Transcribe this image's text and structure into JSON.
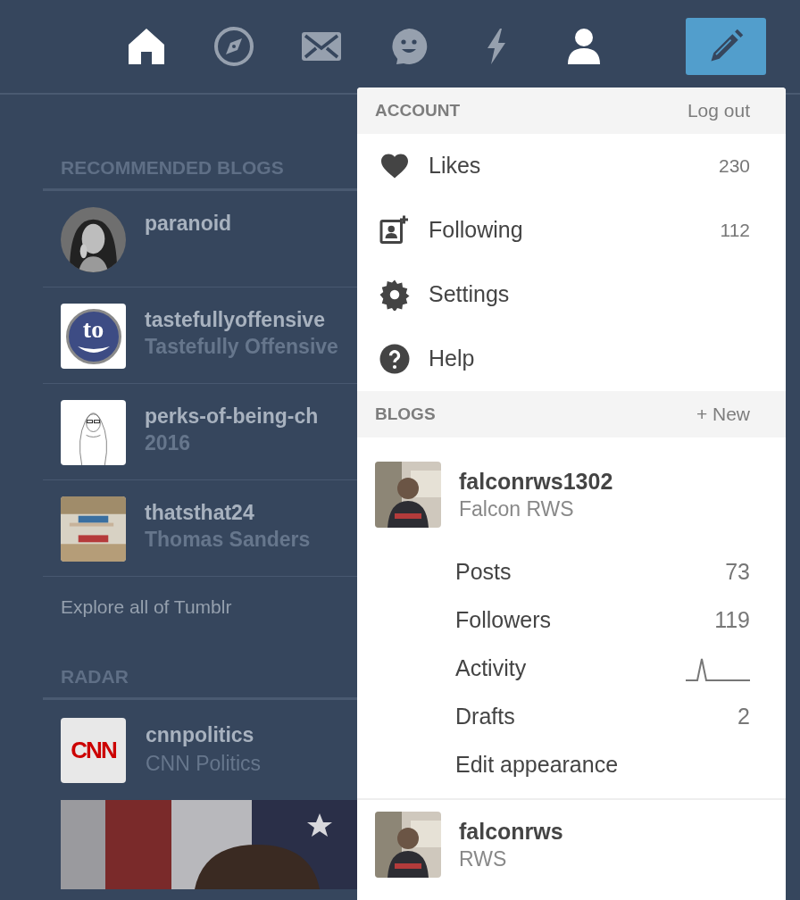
{
  "nav": [
    {
      "kind": "home",
      "selected": true
    },
    {
      "kind": "explore",
      "selected": false
    },
    {
      "kind": "inbox",
      "selected": false
    },
    {
      "kind": "messaging",
      "selected": false
    },
    {
      "kind": "activity",
      "selected": false
    },
    {
      "kind": "account",
      "selected": true
    }
  ],
  "recommended": {
    "heading": "RECOMMENDED BLOGS",
    "blogs": [
      {
        "kind": "picture",
        "name": "paranoid"
      },
      {
        "kind": "logo",
        "logo_text": "to",
        "name": "tastefullyoffensive",
        "title": "Tastefully Offensive"
      },
      {
        "kind": "sketch",
        "name": "perks-of-being-ch",
        "title": "2016"
      },
      {
        "kind": "picture",
        "name": "thatsthat24",
        "title": "Thomas Sanders"
      }
    ],
    "explore": "Explore all of Tumblr"
  },
  "radar": {
    "heading": "RADAR",
    "blog": {
      "logo_text": "CNN",
      "name": "cnnpolitics",
      "title": "CNN Politics"
    }
  },
  "account_menu": {
    "heading": "ACCOUNT",
    "logout": "Log out",
    "items": [
      {
        "kind": "likes",
        "label": "Likes",
        "count": "230"
      },
      {
        "kind": "following",
        "label": "Following",
        "count": "112"
      },
      {
        "kind": "settings",
        "label": "Settings"
      },
      {
        "kind": "help",
        "label": "Help"
      }
    ],
    "blogs_heading": "BLOGS",
    "new": "+ New",
    "blogs": [
      {
        "name": "falconrws1302",
        "title": "Falcon RWS",
        "stats": [
          {
            "kind": "count",
            "label": "Posts",
            "value": "73"
          },
          {
            "kind": "count",
            "label": "Followers",
            "value": "119"
          },
          {
            "kind": "sparkline",
            "label": "Activity"
          },
          {
            "kind": "count",
            "label": "Drafts",
            "value": "2"
          },
          {
            "kind": "link",
            "label": "Edit appearance"
          }
        ]
      },
      {
        "name": "falconrws",
        "title": "RWS"
      }
    ]
  }
}
